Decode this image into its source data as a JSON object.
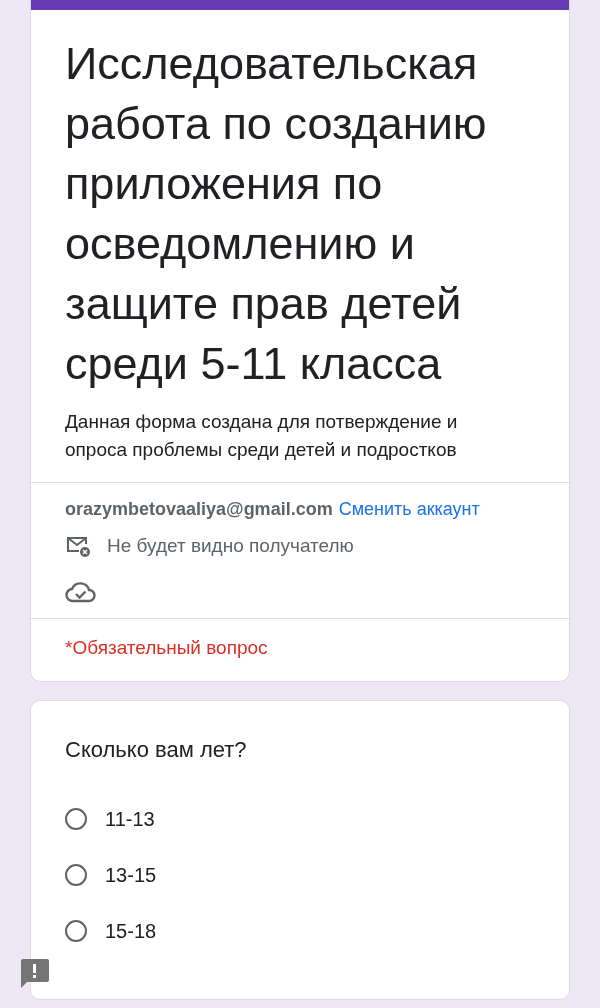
{
  "form": {
    "title": "Исследовательская работа по созданию приложения по осведомлению и защите прав детей среди 5-11 класса",
    "description": "Данная форма создана для потверждение и опроса проблемы среди детей и подростков",
    "account": {
      "email": "orazymbetovaaliya@gmail.com",
      "switch_link": "Сменить аккаунт"
    },
    "email_notice": "Не будет видно получателю",
    "required_note": "*Обязательный вопрос"
  },
  "questions": [
    {
      "text": "Сколько вам лет?",
      "options": [
        {
          "label": "11-13",
          "selected": false
        },
        {
          "label": "13-15",
          "selected": false
        },
        {
          "label": "15-18",
          "selected": false
        }
      ]
    }
  ]
}
